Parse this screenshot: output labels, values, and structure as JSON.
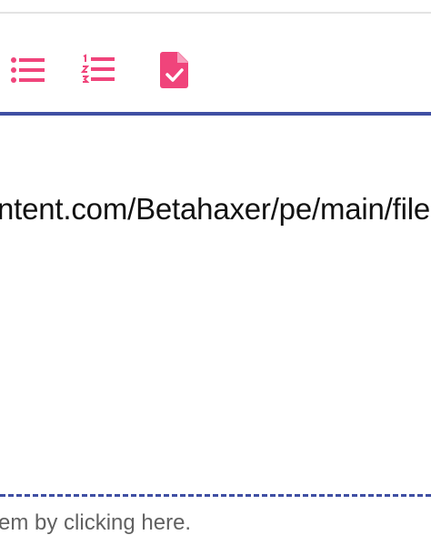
{
  "toolbar": {
    "buttons": [
      {
        "icon": "bullet-list-icon"
      },
      {
        "icon": "numbered-list-icon"
      },
      {
        "icon": "task-file-icon"
      }
    ],
    "icon_color": "#f0447b",
    "accent_color": "#3f4fa3"
  },
  "editor": {
    "text": "ntent.com/Betahaxer/pe/main/file"
  },
  "footer": {
    "hint": "em by clicking here."
  }
}
